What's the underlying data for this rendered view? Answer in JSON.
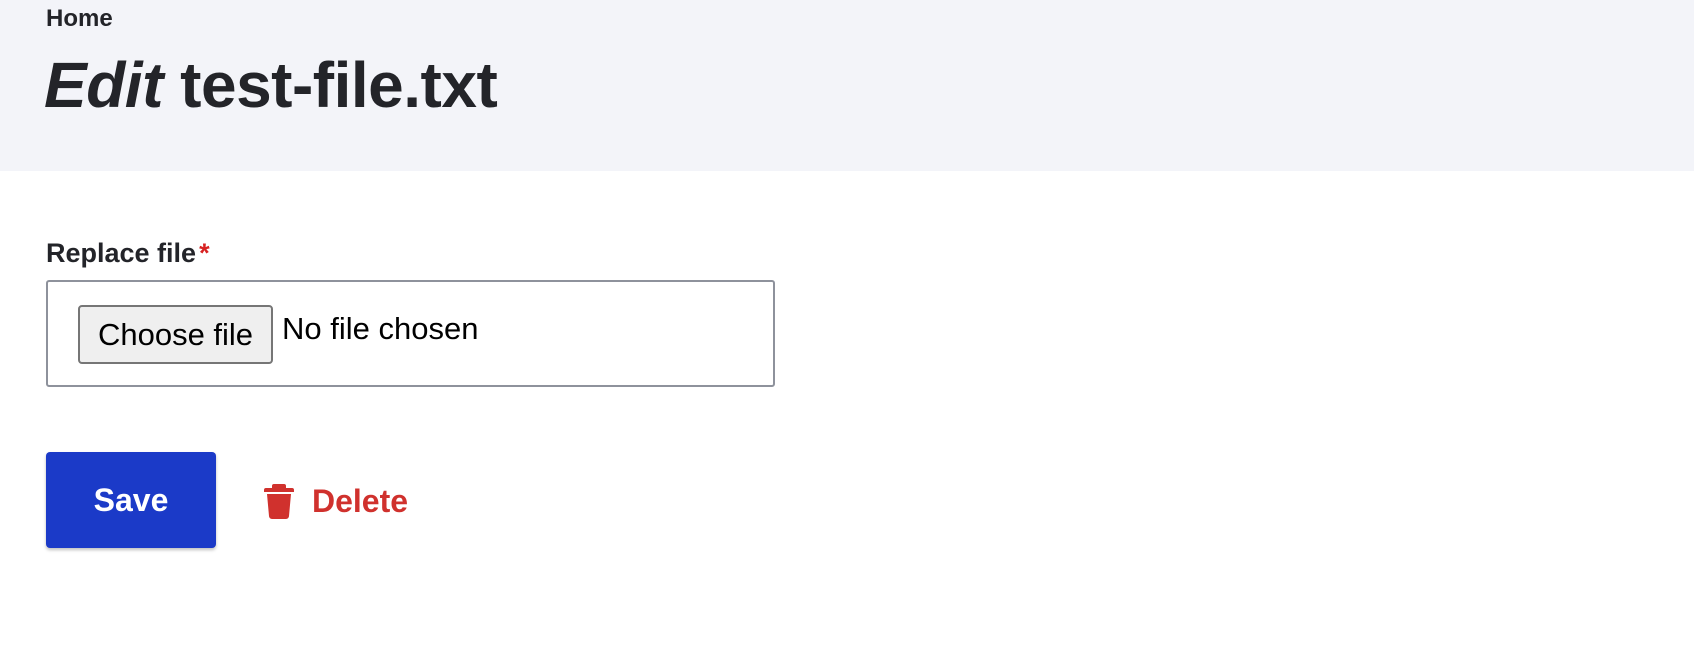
{
  "header": {
    "breadcrumb": "Home",
    "title_prefix": "Edit",
    "title_filename": "test-file.txt"
  },
  "form": {
    "replace_file_label": "Replace file",
    "required_marker": "*",
    "choose_file_label": "Choose file",
    "file_status": "No file chosen",
    "save_label": "Save",
    "delete_label": "Delete"
  },
  "colors": {
    "header_bg": "#f3f4f9",
    "primary": "#1b3ac8",
    "danger": "#d0312d",
    "required": "#d72222",
    "text": "#232429"
  },
  "icons": {
    "delete": "trash-icon"
  }
}
